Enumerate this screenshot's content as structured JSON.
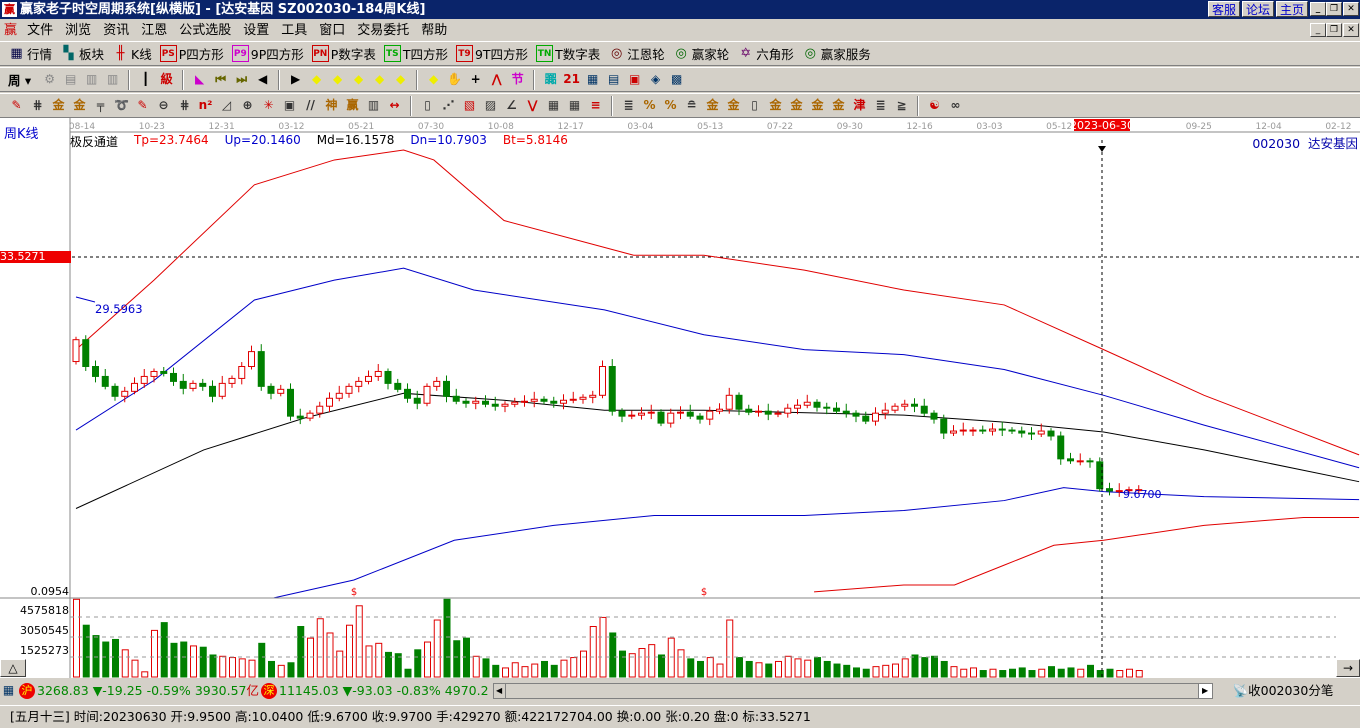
{
  "window": {
    "title": "赢家老子时空周期系统[纵横版] - [达安基因   SZ002030-184周K线]",
    "logo": "赢",
    "buttons": [
      "客服",
      "论坛",
      "主页"
    ]
  },
  "menu": [
    "文件",
    "浏览",
    "资讯",
    "江恩",
    "公式选股",
    "设置",
    "工具",
    "窗口",
    "交易委托",
    "帮助"
  ],
  "toolbar1": [
    {
      "icon": "▦",
      "label": "行情",
      "color": "#004"
    },
    {
      "icon": "▚",
      "label": "板块",
      "color": "#066"
    },
    {
      "icon": "╫",
      "label": "K线",
      "color": "#c00"
    },
    {
      "icon": "PS",
      "label": "P四方形",
      "color": "#c00"
    },
    {
      "icon": "P9",
      "label": "9P四方形",
      "color": "#c0c"
    },
    {
      "icon": "PN",
      "label": "P数字表",
      "color": "#c00"
    },
    {
      "icon": "TS",
      "label": "T四方形",
      "color": "#0a0"
    },
    {
      "icon": "T9",
      "label": "9T四方形",
      "color": "#c00"
    },
    {
      "icon": "TN",
      "label": "T数字表",
      "color": "#0a0"
    },
    {
      "icon": "◎",
      "label": "江恩轮",
      "color": "#600"
    },
    {
      "icon": "◎",
      "label": "赢家轮",
      "color": "#060"
    },
    {
      "icon": "✡",
      "label": "六角形",
      "color": "#606"
    },
    {
      "icon": "◎",
      "label": "赢家服务",
      "color": "#060"
    }
  ],
  "toolbar2": {
    "period": "周",
    "icons": [
      [
        "settings",
        "⚙",
        "#888"
      ],
      [
        "doc",
        "▤",
        "#888"
      ],
      [
        "bars3",
        "▥",
        "#888"
      ],
      [
        "bars9",
        "▥",
        "#888"
      ],
      [
        "candle",
        "┃",
        "#000"
      ],
      [
        "pole",
        "級",
        "#c00"
      ],
      [
        "flag",
        "◣",
        "#c0c"
      ],
      [
        "first",
        "⏮",
        "#660"
      ],
      [
        "last",
        "⏭",
        "#660"
      ],
      [
        "left",
        "◀",
        "#000"
      ],
      [
        "right",
        "▶",
        "#000"
      ],
      [
        "d1",
        "◆",
        "#ee0"
      ],
      [
        "d2",
        "◆",
        "#ee0"
      ],
      [
        "d3",
        "◆",
        "#ee0"
      ],
      [
        "d4",
        "◆",
        "#ee0"
      ],
      [
        "d5",
        "◆",
        "#ee0"
      ],
      [
        "d6",
        "◆",
        "#ee0"
      ],
      [
        "hand",
        "✋",
        "#000"
      ],
      [
        "cross",
        "+",
        "#000"
      ],
      [
        "wave",
        "⋀",
        "#c00"
      ],
      [
        "tpl",
        "节",
        "#c0c"
      ],
      [
        "chart2",
        "嚻",
        "#0aa"
      ],
      [
        "cal",
        "21",
        "#c00"
      ],
      [
        "calc",
        "▦",
        "#036"
      ],
      [
        "list",
        "▤",
        "#036"
      ],
      [
        "save",
        "▣",
        "#c00"
      ],
      [
        "net",
        "◈",
        "#036"
      ],
      [
        "prn",
        "▩",
        "#036"
      ]
    ]
  },
  "toolbar3": [
    "✎",
    "⋕",
    "金",
    "金",
    "╤",
    "➰",
    "✎",
    "⊖",
    "⋕",
    "n²",
    "◿",
    "⊕",
    "✳",
    "▣",
    "//",
    "神",
    "赢",
    "▥",
    "↔",
    "▯",
    "⋰",
    "▧",
    "▨",
    "∠",
    "⋁",
    "▦",
    "▦",
    "≡",
    "≣",
    "%",
    "%",
    "≘",
    "金",
    "金",
    "▯",
    "金",
    "金",
    "金",
    "金",
    "津",
    "≣",
    "≧",
    "☯",
    "∞"
  ],
  "chart": {
    "panel_label": "周K线",
    "indicator": "极反通道",
    "tp": "Tp=23.7464",
    "up": "Up=20.1460",
    "md": "Md=16.1578",
    "dn": "Dn=10.7903",
    "bt": "Bt=5.8146",
    "stock": "002030  达安基因",
    "x_ticks": [
      "08-14",
      "10-23",
      "12-31",
      "03-12",
      "05-21",
      "07-30",
      "10-08",
      "12-17",
      "03-04",
      "05-13",
      "07-22",
      "09-30",
      "12-16",
      "03-03",
      "05-12",
      "2023-06-30",
      "09-25",
      "12-04",
      "02-12"
    ],
    "price_marker": "33.5271",
    "high_label": "29.5963",
    "low_label": "9.6700",
    "cursor_date": "2023-06-30",
    "vol_labels": [
      "0.0954",
      "4575818",
      "3050545",
      "1525273"
    ],
    "first_open": 23.0,
    "closes": [
      25.2,
      22.5,
      21.5,
      20.5,
      19.5,
      20.0,
      20.8,
      21.5,
      22.0,
      21.8,
      21.0,
      20.3,
      20.8,
      20.5,
      19.5,
      20.8,
      21.3,
      22.5,
      24.0,
      20.5,
      19.8,
      20.2,
      17.5,
      17.3,
      17.8,
      18.5,
      19.3,
      19.8,
      20.5,
      21.0,
      21.5,
      22.0,
      20.8,
      20.2,
      19.3,
      18.8,
      20.5,
      21.0,
      19.5,
      19.0,
      18.8,
      19.0,
      18.7,
      18.5,
      18.7,
      18.9,
      19.0,
      19.2,
      19.0,
      18.8,
      19.1,
      19.2,
      19.4,
      19.6,
      22.5,
      18.0,
      17.5,
      17.6,
      17.8,
      17.9,
      16.8,
      17.8,
      17.9,
      17.5,
      17.2,
      18.0,
      18.2,
      19.6,
      18.2,
      17.9,
      18.0,
      17.7,
      17.8,
      18.3,
      18.6,
      18.9,
      18.4,
      18.3,
      18.0,
      17.8,
      17.5,
      17.0,
      17.8,
      18.1,
      18.5,
      18.7,
      18.5,
      17.8,
      17.2,
      15.8,
      16.0,
      16.1,
      16.1,
      16.0,
      16.2,
      16.1,
      16.0,
      15.8,
      15.7,
      16.0,
      15.5,
      13.2,
      13.0,
      13.0,
      12.9,
      10.2,
      9.97,
      10.0,
      10.1,
      10.1
    ],
    "volumes": [
      6.0,
      4.0,
      3.2,
      2.7,
      2.9,
      2.1,
      1.3,
      0.4,
      3.6,
      4.2,
      2.6,
      2.7,
      2.4,
      2.3,
      1.7,
      1.6,
      1.5,
      1.4,
      1.3,
      2.6,
      1.2,
      0.9,
      1.1,
      3.9,
      3.0,
      4.5,
      3.4,
      2.0,
      4.0,
      5.5,
      2.4,
      2.6,
      1.9,
      1.8,
      0.6,
      2.1,
      2.7,
      4.4,
      6.0,
      2.8,
      3.0,
      1.6,
      1.4,
      0.9,
      0.7,
      1.1,
      0.8,
      1.0,
      1.2,
      0.9,
      1.3,
      1.5,
      2.0,
      3.9,
      4.6,
      3.4,
      2.0,
      1.8,
      2.2,
      2.5,
      1.7,
      3.0,
      2.1,
      1.4,
      1.2,
      1.5,
      1.0,
      4.4,
      1.5,
      1.2,
      1.1,
      1.0,
      1.2,
      1.6,
      1.4,
      1.3,
      1.5,
      1.2,
      1.0,
      0.9,
      0.7,
      0.6,
      0.8,
      0.9,
      1.0,
      1.4,
      1.7,
      1.5,
      1.6,
      1.2,
      0.8,
      0.6,
      0.7,
      0.5,
      0.6,
      0.5,
      0.6,
      0.7,
      0.5,
      0.6,
      0.8,
      0.6,
      0.7,
      0.6,
      0.9,
      0.5,
      0.6,
      0.5,
      0.6,
      0.5
    ],
    "vol_max": 6101090,
    "vol_unit": 1000000,
    "bands": [
      {
        "name": "tp",
        "color": "#e00000",
        "pts": [
          [
            0,
            24.2
          ],
          [
            8,
            31.2
          ],
          [
            18.3,
            40.8
          ],
          [
            26.5,
            43.3
          ],
          [
            33.6,
            44.3
          ],
          [
            36.7,
            43.3
          ],
          [
            43.9,
            37.2
          ],
          [
            57.2,
            33.7
          ],
          [
            64.4,
            33.7
          ],
          [
            74.7,
            32.2
          ],
          [
            84.9,
            30.2
          ],
          [
            95.2,
            28.7
          ],
          [
            105.4,
            24.2
          ],
          [
            115.7,
            19.6
          ],
          [
            131.6,
            13.6
          ]
        ]
      },
      {
        "name": "up",
        "color": "#0000c8",
        "pts": [
          [
            0,
            16.1
          ],
          [
            8,
            21.1
          ],
          [
            18.3,
            29.2
          ],
          [
            26.5,
            31.2
          ],
          [
            33.6,
            32.4
          ],
          [
            40.8,
            30.2
          ],
          [
            54.2,
            28.2
          ],
          [
            64.4,
            25.7
          ],
          [
            74.7,
            24.2
          ],
          [
            84.9,
            23.7
          ],
          [
            95.2,
            22.2
          ],
          [
            105.4,
            19.6
          ],
          [
            115.7,
            16.6
          ],
          [
            131.6,
            12.3
          ]
        ]
      },
      {
        "name": "md",
        "color": "#000000",
        "pts": [
          [
            0,
            8.2
          ],
          [
            13.1,
            14.1
          ],
          [
            23.4,
            17.3
          ],
          [
            33.6,
            19.8
          ],
          [
            43.9,
            19.1
          ],
          [
            54.2,
            18.1
          ],
          [
            64.4,
            18.1
          ],
          [
            84.9,
            17.6
          ],
          [
            95.2,
            16.9
          ],
          [
            105.4,
            15.9
          ],
          [
            115.7,
            14.1
          ],
          [
            131.6,
            10.9
          ]
        ]
      },
      {
        "name": "dn",
        "color": "#0000c8",
        "pts": [
          [
            20.3,
            -0.8
          ],
          [
            28.5,
            1.0
          ],
          [
            38.8,
            5.0
          ],
          [
            49,
            6.5
          ],
          [
            59.3,
            7.5
          ],
          [
            74.7,
            7.5
          ],
          [
            84.9,
            8.0
          ],
          [
            95.2,
            9.0
          ],
          [
            101.3,
            10.3
          ],
          [
            105.4,
            9.9
          ],
          [
            115.7,
            9.4
          ],
          [
            131.6,
            9.1
          ]
        ]
      },
      {
        "name": "bt",
        "color": "#e00000",
        "pts": [
          [
            75.7,
            -0.2
          ],
          [
            84.9,
            0.5
          ],
          [
            90.1,
            0.5
          ],
          [
            95.2,
            2.5
          ],
          [
            100.3,
            4.5
          ],
          [
            105.4,
            5.0
          ],
          [
            115.7,
            6.5
          ],
          [
            125.9,
            7.3
          ],
          [
            131.6,
            7.3
          ]
        ]
      }
    ],
    "colors": {
      "up": "#e00000",
      "down": "#008000"
    }
  },
  "market": {
    "sh_badge": "沪",
    "sh": "3268.83",
    "sh_chg": "▼-19.25",
    "sh_pct": "-0.59%",
    "sh_amt": "3930.57",
    "sh_unit": "亿",
    "sz_badge": "深",
    "sz": "11145.03",
    "sz_chg": "▼-93.03",
    "sz_pct": "-0.83%",
    "sz_amt": "4970.2",
    "status": "收002030分笔"
  },
  "status_line": "[五月十三] 时间:20230630 开:9.9500 高:10.0400 低:9.6700 收:9.9700 手:429270 额:422172704.00 换:0.00 张:0.20 盘:0 标:33.5271"
}
